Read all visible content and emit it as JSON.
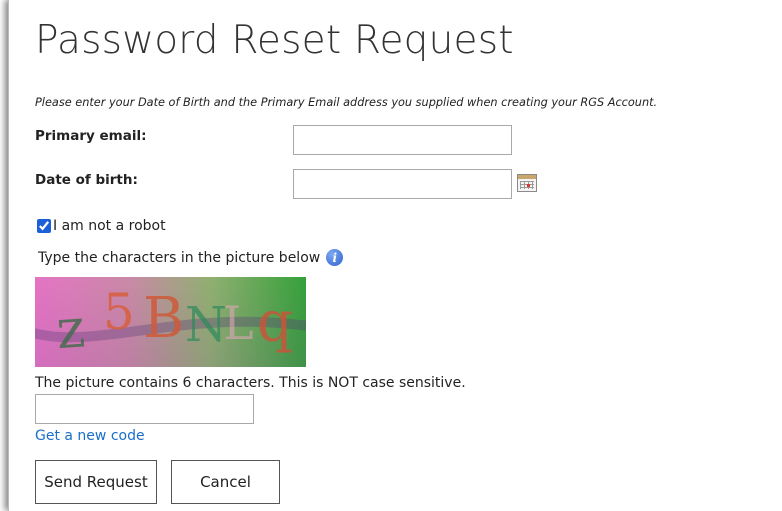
{
  "page": {
    "title": "Password Reset Request",
    "intro": "Please enter your Date of Birth and the Primary Email address you supplied when creating your RGS Account."
  },
  "form": {
    "email_label": "Primary email:",
    "email_value": "",
    "dob_label": "Date of birth:",
    "dob_value": "",
    "calendar_icon": "calendar-icon"
  },
  "robot": {
    "checked": true,
    "label": "I am not a robot"
  },
  "captcha": {
    "hint": "Type the characters in the picture below",
    "info_icon": "info-icon",
    "info_glyph": "i",
    "text": "z5BNLq",
    "note": "The picture contains 6 characters. This is NOT case sensitive.",
    "code_value": "",
    "new_code_link": "Get a new code"
  },
  "buttons": {
    "send": "Send Request",
    "cancel": "Cancel"
  },
  "colors": {
    "link": "#1a6fc9",
    "info": "#2d63cf"
  }
}
